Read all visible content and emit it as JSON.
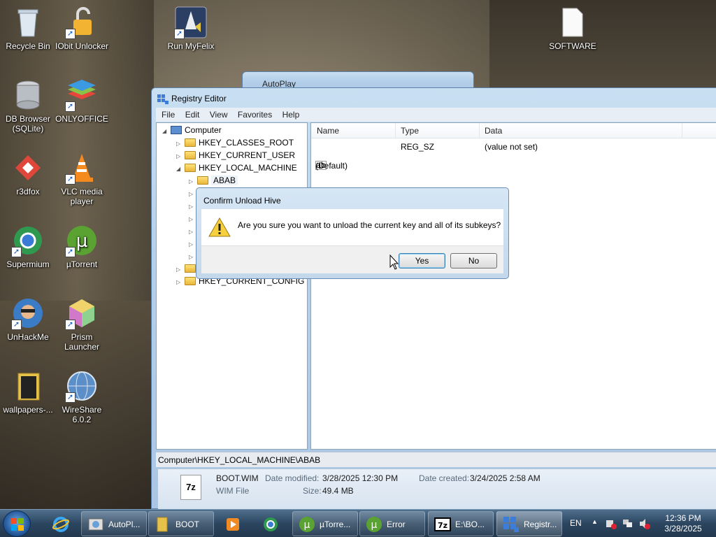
{
  "desktop": {
    "icons": [
      {
        "label": "Recycle Bin"
      },
      {
        "label": "IObit Unlocker"
      },
      {
        "label": "Run MyFelix"
      },
      {
        "label": "SOFTWARE"
      },
      {
        "label": "DB Browser (SQLite)"
      },
      {
        "label": "ONLYOFFICE"
      },
      {
        "label": "r3dfox"
      },
      {
        "label": "VLC media player"
      },
      {
        "label": "Supermium"
      },
      {
        "label": "µTorrent"
      },
      {
        "label": "UnHackMe"
      },
      {
        "label": "Prism Launcher"
      },
      {
        "label": "wallpapers-..."
      },
      {
        "label": "WireShare 6.0.2"
      }
    ]
  },
  "autoplay": {
    "title": "AutoPlay"
  },
  "regedit": {
    "title": "Registry Editor",
    "menu": [
      "File",
      "Edit",
      "View",
      "Favorites",
      "Help"
    ],
    "tree": {
      "root": "Computer",
      "nodes": [
        "HKEY_CLASSES_ROOT",
        "HKEY_CURRENT_USER",
        "HKEY_LOCAL_MACHINE",
        "ABAB",
        "HKEY_CURRENT_CONFIG"
      ]
    },
    "columns": [
      "Name",
      "Type",
      "Data"
    ],
    "values": [
      {
        "name": "(Default)",
        "type": "REG_SZ",
        "data": "(value not set)"
      }
    ],
    "status": "Computer\\HKEY_LOCAL_MACHINE\\ABAB"
  },
  "dialog": {
    "title": "Confirm Unload Hive",
    "message": "Are you sure you want to unload the current key and all of its subkeys?",
    "yes": "Yes",
    "no": "No"
  },
  "explorer_details": {
    "file_name": "BOOT.WIM",
    "file_type": "WIM File",
    "modified_label": "Date modified:",
    "modified_value": "3/28/2025 12:30 PM",
    "created_label": "Date created:",
    "created_value": "3/24/2025 2:58 AM",
    "size_label": "Size:",
    "size_value": "49.4 MB",
    "icon_text": "7z"
  },
  "taskbar": {
    "items": [
      {
        "label": "AutoPl..."
      },
      {
        "label": "BOOT"
      },
      {
        "label": "µTorre..."
      },
      {
        "label": "Error"
      },
      {
        "label": "E:\\BO..."
      },
      {
        "label": "Registr..."
      }
    ],
    "language": "EN",
    "time": "12:36 PM",
    "date": "3/28/2025"
  }
}
